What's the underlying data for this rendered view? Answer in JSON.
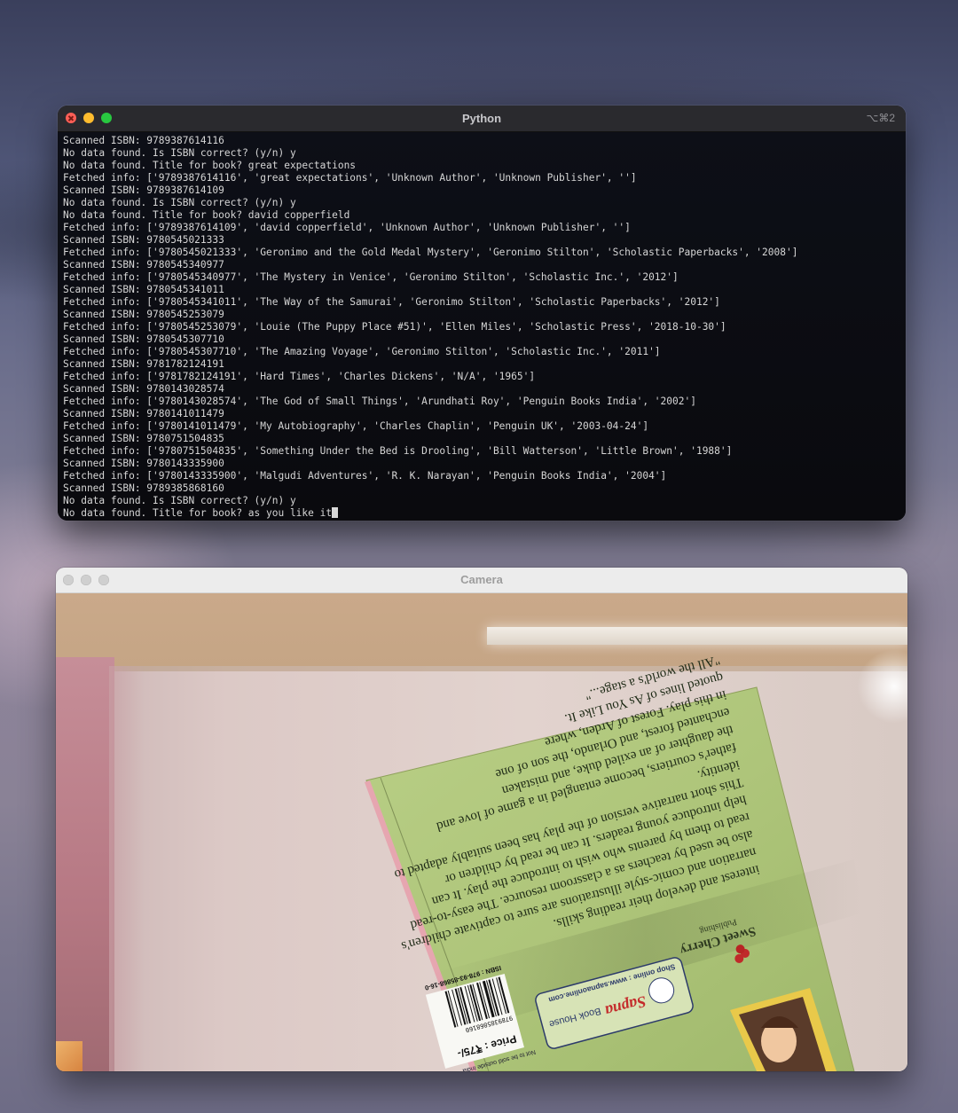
{
  "terminal": {
    "title": "Python",
    "shortcut": "⌥⌘2",
    "lines": [
      "Scanned ISBN: 9789387614116",
      "No data found. Is ISBN correct? (y/n) y",
      "No data found. Title for book? great expectations",
      "Fetched info: ['9789387614116', 'great expectations', 'Unknown Author', 'Unknown Publisher', '']",
      "Scanned ISBN: 9789387614109",
      "No data found. Is ISBN correct? (y/n) y",
      "No data found. Title for book? david copperfield",
      "Fetched info: ['9789387614109', 'david copperfield', 'Unknown Author', 'Unknown Publisher', '']",
      "Scanned ISBN: 9780545021333",
      "Fetched info: ['9780545021333', 'Geronimo and the Gold Medal Mystery', 'Geronimo Stilton', 'Scholastic Paperbacks', '2008']",
      "Scanned ISBN: 9780545340977",
      "Fetched info: ['9780545340977', 'The Mystery in Venice', 'Geronimo Stilton', 'Scholastic Inc.', '2012']",
      "Scanned ISBN: 9780545341011",
      "Fetched info: ['9780545341011', 'The Way of the Samurai', 'Geronimo Stilton', 'Scholastic Paperbacks', '2012']",
      "Scanned ISBN: 9780545253079",
      "Fetched info: ['9780545253079', 'Louie (The Puppy Place #51)', 'Ellen Miles', 'Scholastic Press', '2018-10-30']",
      "Scanned ISBN: 9780545307710",
      "Fetched info: ['9780545307710', 'The Amazing Voyage', 'Geronimo Stilton', 'Scholastic Inc.', '2011']",
      "Scanned ISBN: 9781782124191",
      "Fetched info: ['9781782124191', 'Hard Times', 'Charles Dickens', 'N/A', '1965']",
      "Scanned ISBN: 9780143028574",
      "Fetched info: ['9780143028574', 'The God of Small Things', 'Arundhati Roy', 'Penguin Books India', '2002']",
      "Scanned ISBN: 9780141011479",
      "Fetched info: ['9780141011479', 'My Autobiography', 'Charles Chaplin', 'Penguin UK', '2003-04-24']",
      "Scanned ISBN: 9780751504835",
      "Fetched info: ['9780751504835', 'Something Under the Bed is Drooling', 'Bill Watterson', 'Little Brown', '1988']",
      "Scanned ISBN: 9780143335900",
      "Fetched info: ['9780143335900', 'Malgudi Adventures', 'R. K. Narayan', 'Penguin Books India', '2004']",
      "Scanned ISBN: 9789385868160",
      "No data found. Is ISBN correct? (y/n) y"
    ],
    "prompt_line": "No data found. Title for book? as you like it"
  },
  "camera": {
    "title": "Camera",
    "book": {
      "publisher_logo": "Sweet Cherry",
      "publisher_sub": "Publishing",
      "store_name": "Sapna",
      "store_suffix": "Book House",
      "store_url": "Shop online : www.sapnaonline.com",
      "price": "Price : ₹75/-",
      "not_for_sale": "Not to be sold outside India",
      "isbn_label": "ISBN : 978-93-85868-16-0",
      "barcode_digits": "9789385868160",
      "blurb_lines": [
        "\"All the world's a stage...\"",
        "quoted lines of As You Like It.",
        "in this play. Forest of Arden, where",
        "enchanted forest, and Orlando, the son of one",
        "the daughter of an exiled duke, and mistaken",
        "father's courtiers, become entangled in a game of love and",
        "identity.",
        "This short narrative version of the play has been suitably adapted to",
        "help introduce young readers. It can be read by children or",
        "read to them by parents who wish to introduce the play. It can",
        "also be used by teachers as a classroom resource. The easy-to-read",
        "narration and comic-style illustrations are sure to captivate children's",
        "interest and develop their reading skills."
      ]
    }
  }
}
